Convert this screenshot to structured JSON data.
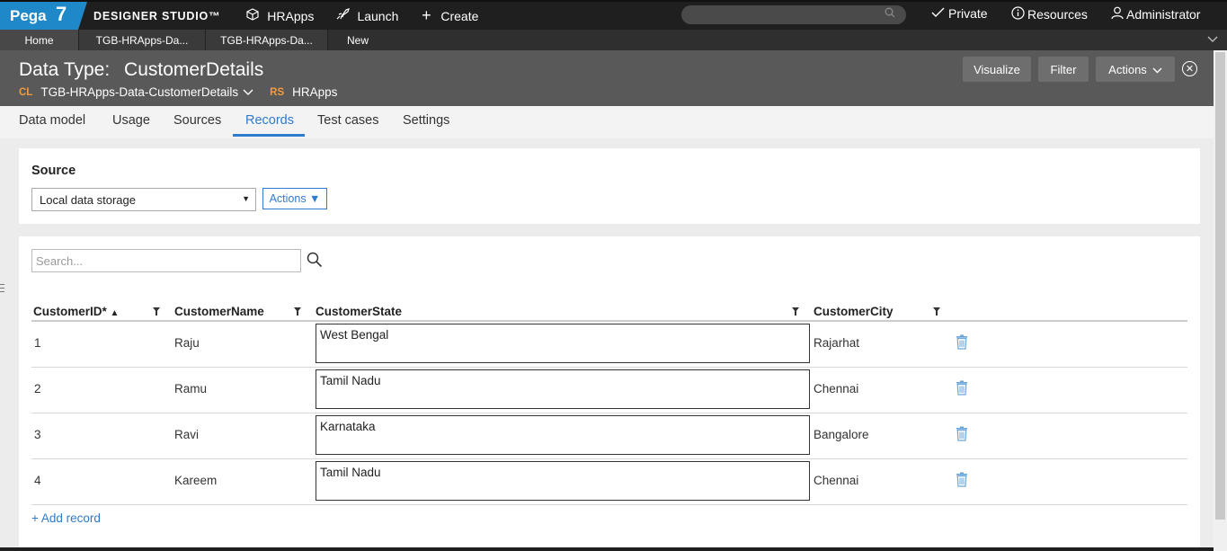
{
  "topbar": {
    "logo_text": "Pega",
    "logo_version": "7",
    "studio": "DESIGNER STUDIO™",
    "nav": [
      {
        "icon": "cube-icon",
        "label": "HRApps"
      },
      {
        "icon": "rocket-icon",
        "label": "Launch"
      },
      {
        "icon": "plus-icon",
        "label": "Create"
      }
    ],
    "search_placeholder": "",
    "right": [
      {
        "icon": "check-icon",
        "label": "Private"
      },
      {
        "icon": "info-icon",
        "label": "Resources"
      },
      {
        "icon": "user-icon",
        "label": "Administrator"
      }
    ]
  },
  "tabs": [
    {
      "label": "Home"
    },
    {
      "label": "TGB-HRApps-Da..."
    },
    {
      "label": "TGB-HRApps-Da..."
    },
    {
      "label": "New"
    }
  ],
  "header": {
    "title_prefix": "Data Type:",
    "title_name": "CustomerDetails",
    "class_tag": "CL",
    "class_value": "TGB-HRApps-Data-CustomerDetails",
    "ruleset_tag": "RS",
    "ruleset_value": "HRApps",
    "buttons": {
      "visualize": "Visualize",
      "filter": "Filter",
      "actions": "Actions"
    }
  },
  "rule_tabs": [
    {
      "label": "Data model",
      "active": false
    },
    {
      "label": "Usage",
      "active": false
    },
    {
      "label": "Sources",
      "active": false
    },
    {
      "label": "Records",
      "active": true
    },
    {
      "label": "Test cases",
      "active": false
    },
    {
      "label": "Settings",
      "active": false
    }
  ],
  "source": {
    "label": "Source",
    "selected": "Local data storage",
    "actions_label": "Actions ▼"
  },
  "records": {
    "search_placeholder": "Search...",
    "columns": [
      "CustomerID*",
      "CustomerName",
      "CustomerState",
      "CustomerCity"
    ],
    "rows": [
      {
        "id": "1",
        "name": "Raju",
        "state": "West Bengal",
        "city": "Rajarhat"
      },
      {
        "id": "2",
        "name": "Ramu",
        "state": "Tamil Nadu",
        "city": "Chennai"
      },
      {
        "id": "3",
        "name": "Ravi",
        "state": "Karnataka",
        "city": "Bangalore"
      },
      {
        "id": "4",
        "name": "Kareem",
        "state": "Tamil Nadu",
        "city": "Chennai"
      }
    ],
    "add_record": "+ Add record"
  },
  "colors": {
    "accent": "#2e7bcf",
    "logo_blue": "#1e88c8",
    "tag_orange": "#f39a3c",
    "header_bg": "#595959",
    "topbar_bg": "#1f1f1f"
  }
}
